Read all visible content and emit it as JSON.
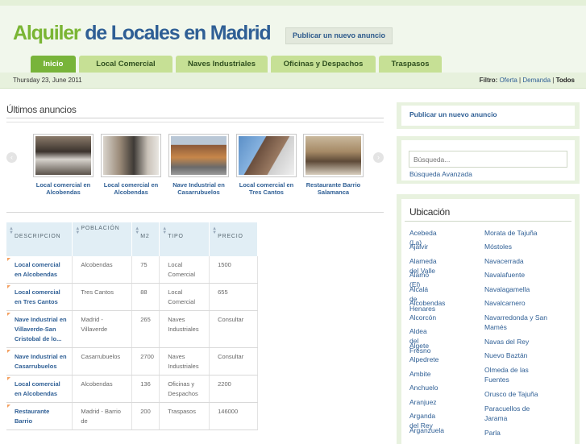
{
  "header": {
    "title_part1": "Alquiler",
    "title_part2": "de Locales en Madrid",
    "publish_button": "Publicar un nuevo anuncio"
  },
  "nav": {
    "tabs": [
      "Inicio",
      "Local Comercial",
      "Naves Industriales",
      "Oficinas y Despachos",
      "Traspasos"
    ],
    "active": "Inicio"
  },
  "datebar": {
    "date": "Thursday 23, June 2011",
    "filter_label": "Filtro:",
    "filter_oferta": "Oferta",
    "filter_demanda": "Demanda",
    "filter_todos": "Todos",
    "separator": "|"
  },
  "main": {
    "section_title": "Últimos anuncios",
    "carousel": [
      {
        "caption": "Local comercial en Alcobendas",
        "icon": "photo-shop-interior"
      },
      {
        "caption": "Local comercial en Alcobendas",
        "icon": "photo-shop-front"
      },
      {
        "caption": "Nave Industrial en Casarrubuelos",
        "icon": "photo-warehouse"
      },
      {
        "caption": "Local comercial en Tres Cantos",
        "icon": "photo-building"
      },
      {
        "caption": "Restaurante Barrio Salamanca",
        "icon": "photo-restaurant"
      }
    ],
    "table": {
      "headers": [
        "DESCRIPCION",
        "POBLACIÓN",
        "M2",
        "TIPO",
        "PRECIO"
      ],
      "rows": [
        {
          "descripcion": "Local comercial en Alcobendas",
          "poblacion": "Alcobendas",
          "m2": "75",
          "tipo": "Local Comercial",
          "precio": "1500"
        },
        {
          "descripcion": "Local comercial en Tres Cantos",
          "poblacion": "Tres Cantos",
          "m2": "88",
          "tipo": "Local Comercial",
          "precio": "655"
        },
        {
          "descripcion": "Nave Industrial en Villaverde-San Cristobal de lo...",
          "poblacion": "Madrid - Villaverde",
          "m2": "265",
          "tipo": "Naves Industriales",
          "precio": "Consultar"
        },
        {
          "descripcion": "Nave Industrial en Casarrubuelos",
          "poblacion": "Casarrubuelos",
          "m2": "2700",
          "tipo": "Naves Industriales",
          "precio": "Consultar"
        },
        {
          "descripcion": "Local comercial en Alcobendas",
          "poblacion": "Alcobendas",
          "m2": "136",
          "tipo": "Oficinas y Despachos",
          "precio": "2200"
        },
        {
          "descripcion": "Restaurante Barrio",
          "poblacion": "Madrid - Barrio de",
          "m2": "200",
          "tipo": "Traspasos",
          "precio": "146000"
        }
      ]
    }
  },
  "sidebar": {
    "publish_link": "Publicar un nuevo anuncio",
    "search_placeholder": "Búsqueda...",
    "search_advanced": "Búsqueda Avanzada",
    "ubicacion_title": "Ubicación",
    "ubicacion_col1": [
      "Acebeda (La)",
      "Ajalvir",
      "Alameda del Valle",
      "Álamo (El)",
      "Alcalá de Henares",
      "Alcobendas",
      "Alcorcón",
      "Aldea del Fresno",
      "Algete",
      "Alpedrete",
      "Ambite",
      "Anchuelo",
      "Aranjuez",
      "Arganda del Rey",
      "Arganzuela"
    ],
    "ubicacion_col2": [
      "Morata de Tajuña",
      "Móstoles",
      "Navacerrada",
      "Navalafuente",
      "Navalagamella",
      "Navalcarnero",
      "Navarredonda y San Mamés",
      "Navas del Rey",
      "Nuevo Baztán",
      "Olmeda de las Fuentes",
      "Orusco de Tajuña",
      "Paracuellos de Jarama",
      "Parla"
    ]
  }
}
